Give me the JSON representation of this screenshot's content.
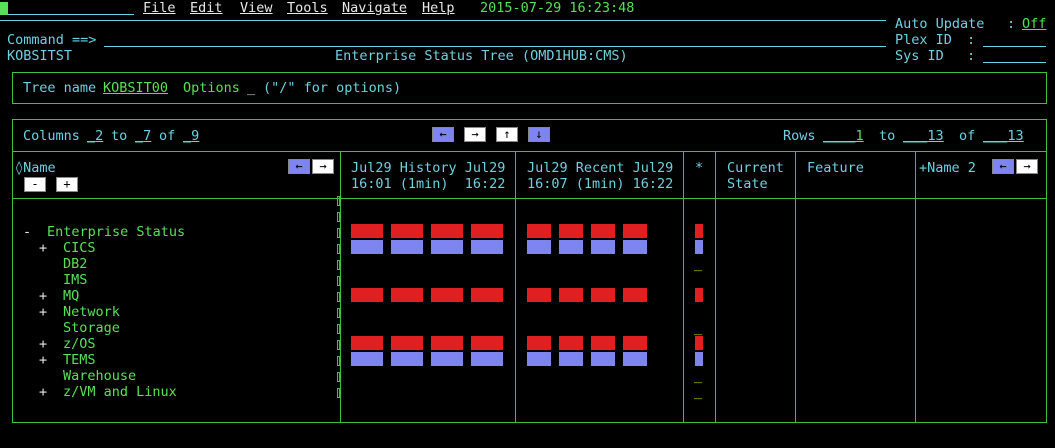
{
  "menu": {
    "items": [
      "File",
      "Edit",
      "View",
      "Tools",
      "Navigate",
      "Help"
    ],
    "datetime": "2015-07-29 16:23:48",
    "auto_update_label": "Auto Update",
    "auto_update_value": "Off",
    "plex_label": "Plex ID",
    "sys_label": "Sys ID"
  },
  "command_label": "Command ==>",
  "system_name": "KOBSITST",
  "screen_title": "Enterprise Status Tree (OMD1HUB:CMS)",
  "tree": {
    "label": "Tree name",
    "name": "KOBSIT00",
    "options_label": "Options",
    "options_value": "_",
    "options_hint": "(\"/\" for options)"
  },
  "columns": {
    "label": "Columns",
    "from": "2",
    "to_label": "to",
    "to": "7",
    "of_label": "of",
    "total": "9"
  },
  "rows": {
    "label": "Rows",
    "from": "1",
    "to_label": "to",
    "to": "13",
    "of_label": "of",
    "total": "13"
  },
  "headers": {
    "name": "◊Name",
    "history_line1": "Jul29 History Jul29",
    "history_line2": "16:01 (1min)  16:22",
    "recent_line1": "Jul29 Recent Jul29",
    "recent_line2": "16:07 (1min) 16:22",
    "star": "*",
    "current_state_1": "Current",
    "current_state_2": "State",
    "feature": "Feature",
    "name2": "+Name 2"
  },
  "nav_arrows": {
    "left": "←",
    "right": "→",
    "up": "↑",
    "down": "↓",
    "minus": "-",
    "plus": "+"
  },
  "tree_rows": [
    {
      "toggle": "-",
      "label": "Enterprise Status"
    },
    {
      "toggle": "+",
      "label": "CICS"
    },
    {
      "toggle": "",
      "label": "DB2"
    },
    {
      "toggle": "",
      "label": "IMS"
    },
    {
      "toggle": "+",
      "label": "MQ"
    },
    {
      "toggle": "+",
      "label": "Network"
    },
    {
      "toggle": "",
      "label": "Storage"
    },
    {
      "toggle": "+",
      "label": "z/OS"
    },
    {
      "toggle": "+",
      "label": "TEMS"
    },
    {
      "toggle": "",
      "label": "Warehouse"
    },
    {
      "toggle": "+",
      "label": "z/VM and Linux"
    }
  ],
  "status_bars": [
    {
      "row": 0,
      "color": "#e02020"
    },
    {
      "row": 1,
      "color": "#7f85f0"
    },
    {
      "row": 4,
      "color": "#e02020"
    },
    {
      "row": 7,
      "color": "#e02020"
    },
    {
      "row": 8,
      "color": "#7f85f0"
    }
  ],
  "star_underscores_rows": [
    2,
    6,
    9,
    10
  ],
  "colors": {
    "background": "#000000",
    "cyan": "#6fd0e0",
    "green": "#58e058",
    "red": "#e02020",
    "blue": "#7f85f0",
    "border": "#3fbf3f"
  }
}
